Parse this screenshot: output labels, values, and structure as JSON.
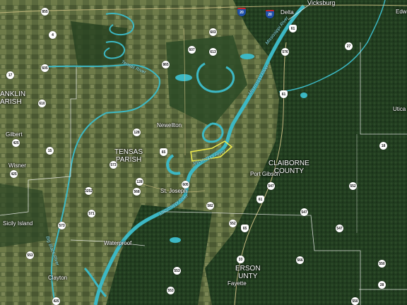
{
  "map": {
    "cities": {
      "vicksburg": "Vicksburg",
      "delta": "Delta",
      "edw": "Edw",
      "newellton": "Newellton",
      "st_joseph": "St. Joseph",
      "port_gibson": "Port Gibson",
      "waterproof": "Waterproof",
      "clayton": "Clayton",
      "fayette": "Fayette",
      "gilbert": "Gilbert",
      "wisner": "Wisner",
      "sicily_island": "Sicily Island",
      "utica": "Utica"
    },
    "regions": {
      "franklin_l1": "ANKLIN",
      "franklin_l2": "ARISH",
      "tensas_l1": "TENSAS",
      "tensas_l2": "PARISH",
      "claiborne_l1": "CLAIBORNE",
      "claiborne_l2": "COUNTY",
      "jefferson_l1": "ERSON",
      "jefferson_l2": "UNTY"
    },
    "rivers": {
      "mississippi_1": "Mississippi River",
      "mississippi_2": "Mississippi River",
      "mississippi_3": "Mississippi River",
      "mississippi_4": "Mississippi River",
      "tensas": "Tensas River",
      "big_black": "Big Black River"
    },
    "routes": [
      {
        "num": "855",
        "type": "state"
      },
      {
        "num": "61",
        "type": "us"
      },
      {
        "num": "603",
        "type": "state"
      },
      {
        "num": "4",
        "type": "state"
      },
      {
        "num": "607",
        "type": "state"
      },
      {
        "num": "865",
        "type": "state"
      },
      {
        "num": "613",
        "type": "state"
      },
      {
        "num": "576",
        "type": "state"
      },
      {
        "num": "17",
        "type": "state"
      },
      {
        "num": "605",
        "type": "state"
      },
      {
        "num": "610",
        "type": "state"
      },
      {
        "num": "27",
        "type": "state"
      },
      {
        "num": "61",
        "type": "us"
      },
      {
        "num": "425",
        "type": "state"
      },
      {
        "num": "15",
        "type": "state"
      },
      {
        "num": "128",
        "type": "state"
      },
      {
        "num": "65",
        "type": "us"
      },
      {
        "num": "573",
        "type": "state"
      },
      {
        "num": "425",
        "type": "state"
      },
      {
        "num": "3252",
        "type": "state"
      },
      {
        "num": "568",
        "type": "state"
      },
      {
        "num": "128",
        "type": "state"
      },
      {
        "num": "605",
        "type": "state"
      },
      {
        "num": "582",
        "type": "state"
      },
      {
        "num": "18",
        "type": "state"
      },
      {
        "num": "547",
        "type": "state"
      },
      {
        "num": "552",
        "type": "state"
      },
      {
        "num": "61",
        "type": "us"
      },
      {
        "num": "547",
        "type": "state"
      },
      {
        "num": "547",
        "type": "state"
      },
      {
        "num": "573",
        "type": "state"
      },
      {
        "num": "571",
        "type": "state"
      },
      {
        "num": "65",
        "type": "us"
      },
      {
        "num": "552",
        "type": "state"
      },
      {
        "num": "566",
        "type": "state"
      },
      {
        "num": "553",
        "type": "state"
      },
      {
        "num": "553",
        "type": "state"
      },
      {
        "num": "33",
        "type": "state"
      },
      {
        "num": "550",
        "type": "state"
      },
      {
        "num": "28",
        "type": "state"
      },
      {
        "num": "550",
        "type": "state"
      },
      {
        "num": "425",
        "type": "state"
      },
      {
        "num": "553",
        "type": "state"
      },
      {
        "num": "20",
        "type": "interstate"
      },
      {
        "num": "20",
        "type": "interstate"
      }
    ],
    "colors": {
      "land": "#3b4a2c",
      "forest": "#1f3a1d",
      "river": "#3cb8c4",
      "boundary": "#ffffff",
      "highlight": "#f2ee4d"
    }
  }
}
